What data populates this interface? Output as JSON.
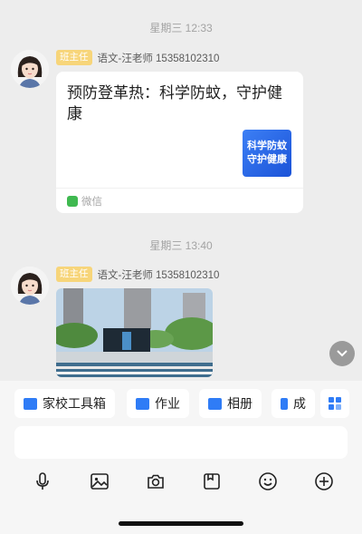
{
  "messages": [
    {
      "time": "星期三 12:33",
      "badge": "班主任",
      "sender": "语文-汪老师 15358102310",
      "type": "link-card",
      "title": "预防登革热：科学防蚊，守护健康",
      "thumbnail_text": [
        "科学防蚊",
        "守护健康"
      ],
      "source": "微信"
    },
    {
      "time": "星期三 13:40",
      "badge": "班主任",
      "sender": "语文-汪老师 15358102310",
      "type": "photo"
    }
  ],
  "toolbar": {
    "chips": [
      {
        "label": "家校工具箱",
        "icon": "toolbox-icon",
        "color": "#2f7cf6"
      },
      {
        "label": "作业",
        "icon": "homework-icon",
        "color": "#2f7cf6"
      },
      {
        "label": "相册",
        "icon": "album-icon",
        "color": "#2f7cf6"
      },
      {
        "label": "成",
        "icon": "grades-icon",
        "color": "#2f7cf6"
      }
    ],
    "more_icon": "apps-grid-icon"
  },
  "input": {
    "placeholder": ""
  },
  "bottom_icons": [
    "microphone-icon",
    "image-icon",
    "camera-icon",
    "file-icon",
    "emoji-icon",
    "plus-icon"
  ],
  "colors": {
    "badge": "#f7d57a",
    "accent": "#2f7cf6",
    "background": "#ededed"
  }
}
